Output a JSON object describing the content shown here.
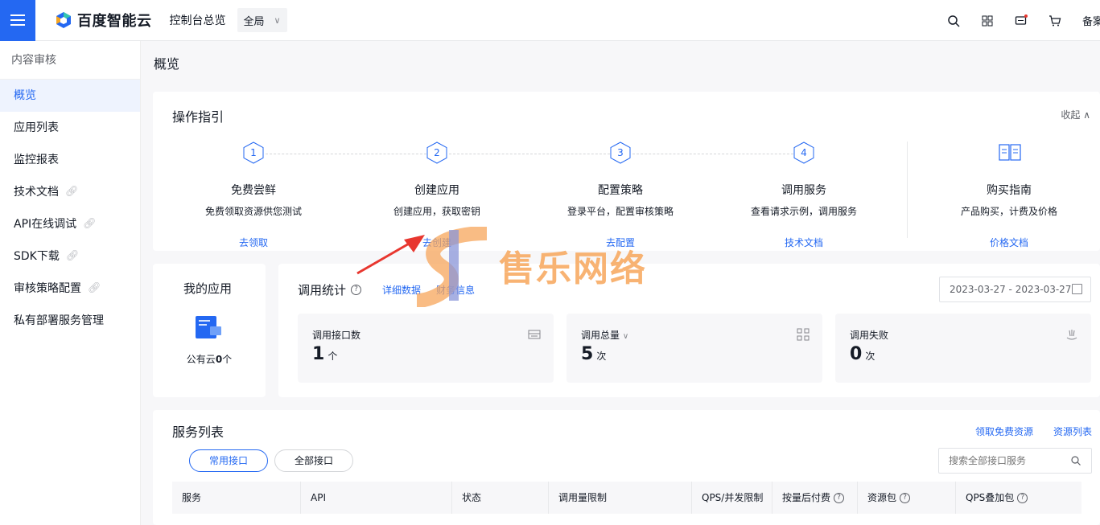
{
  "topbar": {
    "brand": "百度智能云",
    "console": "控制台总览",
    "region": "全局",
    "beian": "备案"
  },
  "sidebar": {
    "title": "内容审核",
    "items": [
      {
        "label": "概览",
        "external": false
      },
      {
        "label": "应用列表",
        "external": false
      },
      {
        "label": "监控报表",
        "external": false
      },
      {
        "label": "技术文档",
        "external": true
      },
      {
        "label": "API在线调试",
        "external": true
      },
      {
        "label": "SDK下载",
        "external": true
      },
      {
        "label": "审核策略配置",
        "external": true
      },
      {
        "label": "私有部署服务管理",
        "external": false
      }
    ]
  },
  "page_title": "概览",
  "guide": {
    "title": "操作指引",
    "collapse": "收起",
    "steps": [
      {
        "num": "1",
        "title": "免费尝鲜",
        "desc": "免费领取资源供您测试",
        "link": "去领取"
      },
      {
        "num": "2",
        "title": "创建应用",
        "desc": "创建应用，获取密钥",
        "link": "去创建"
      },
      {
        "num": "3",
        "title": "配置策略",
        "desc": "登录平台，配置审核策略",
        "link": "去配置"
      },
      {
        "num": "4",
        "title": "调用服务",
        "desc": "查看请求示例，调用服务",
        "link": "技术文档"
      }
    ],
    "buy": {
      "title": "购买指南",
      "desc": "产品购买，计费及价格",
      "link": "价格文档"
    }
  },
  "apps": {
    "title": "我的应用",
    "label": "公有云",
    "count": "0",
    "unit": "个"
  },
  "stats": {
    "title": "调用统计",
    "link_detail": "详细数据",
    "link_finance": "财务信息",
    "date_range": "2023-03-27 - 2023-03-27",
    "boxes": [
      {
        "label": "调用接口数",
        "value": "1",
        "unit": "个"
      },
      {
        "label": "调用总量",
        "value": "5",
        "unit": "次"
      },
      {
        "label": "调用失败",
        "value": "0",
        "unit": "次"
      }
    ]
  },
  "service": {
    "title": "服务列表",
    "link_free": "领取免费资源",
    "link_list": "资源列表",
    "tabs": [
      "常用接口",
      "全部接口"
    ],
    "search_placeholder": "搜索全部接口服务",
    "columns": [
      "服务",
      "API",
      "状态",
      "调用量限制",
      "QPS/并发限制",
      "按量后付费",
      "资源包",
      "QPS叠加包"
    ]
  },
  "watermark": "售乐网络",
  "colors": {
    "accent": "#2468f2",
    "watermark": "#f7a65b",
    "arrow": "#e8372f"
  }
}
